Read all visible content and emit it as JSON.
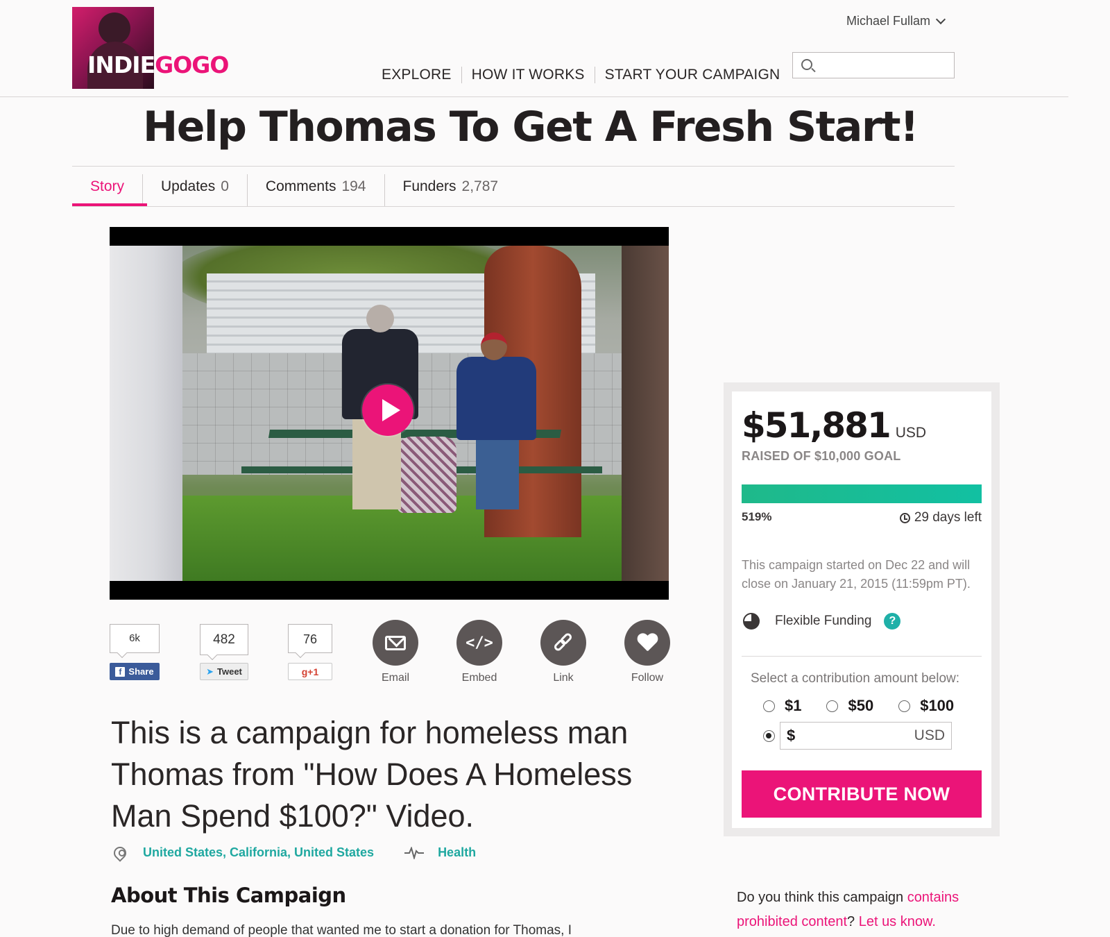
{
  "brand": {
    "logo_part1": "INDIE",
    "logo_part2": "GOGO",
    "accent": "#eb1478",
    "teal": "#1fa8a0"
  },
  "user": {
    "name": "Michael Fullam"
  },
  "nav": {
    "items": [
      "EXPLORE",
      "HOW IT WORKS",
      "START YOUR CAMPAIGN"
    ],
    "search_placeholder": ""
  },
  "campaign": {
    "title": "Help Thomas To Get A Fresh Start!",
    "headline": "This is a campaign for homeless man Thomas from \"How Does A Homeless Man Spend $100?\" Video.",
    "location": "United States, California, United States",
    "category": "Health",
    "about_title": "About This Campaign",
    "about_text": "Due to high demand of people that wanted me to start a donation for Thomas, I"
  },
  "tabs": [
    {
      "label": "Story",
      "count": ""
    },
    {
      "label": "Updates",
      "count": "0"
    },
    {
      "label": "Comments",
      "count": "194"
    },
    {
      "label": "Funders",
      "count": "2,787"
    }
  ],
  "social": {
    "facebook": {
      "count": "6k",
      "label": "Share"
    },
    "twitter": {
      "count": "482",
      "label": "Tweet"
    },
    "google": {
      "count": "76",
      "label": "g+1"
    },
    "actions": [
      "Email",
      "Embed",
      "Link",
      "Follow"
    ]
  },
  "funding": {
    "raised": "$51,881",
    "currency": "USD",
    "goal_text": "RAISED OF $10,000 GOAL",
    "percent_text": "519%",
    "progress_fraction": 1.0,
    "days_left": "29 days left",
    "dates_text": "This campaign started on Dec 22 and will close on January 21, 2015 (11:59pm PT).",
    "funding_type": "Flexible Funding",
    "select_label": "Select a contribution amount below:",
    "options": [
      "$1",
      "$50",
      "$100"
    ],
    "custom_prefix": "$",
    "custom_suffix": "USD",
    "custom_value": "",
    "cta": "CONTRIBUTE NOW"
  },
  "report": {
    "text1": "Do you think this campaign ",
    "link1": "contains prohibited content",
    "text2": "? ",
    "link2": "Let us know."
  }
}
